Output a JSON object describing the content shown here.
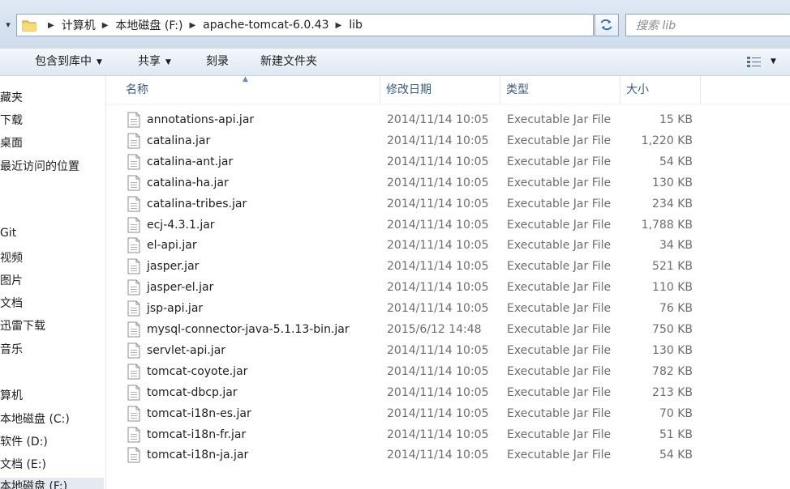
{
  "address": {
    "crumbs": [
      "计算机",
      "本地磁盘 (F:)",
      "apache-tomcat-6.0.43",
      "lib"
    ],
    "search_placeholder": "搜索 lib"
  },
  "toolbar": {
    "include_label": "包含到库中",
    "share_label": "共享",
    "burn_label": "刻录",
    "new_folder_label": "新建文件夹"
  },
  "nav": {
    "items": [
      "藏夹",
      "下载",
      "桌面",
      "最近访问的位置",
      "Git",
      "视频",
      "图片",
      "文档",
      "迅雷下载",
      "音乐",
      "算机",
      "本地磁盘 (C:)",
      "软件 (D:)",
      "文档 (E:)",
      "本地磁盘 (F:)"
    ]
  },
  "columns": {
    "name": "名称",
    "date": "修改日期",
    "type": "类型",
    "size": "大小"
  },
  "files": [
    {
      "name": "annotations-api.jar",
      "date": "2014/11/14 10:05",
      "type": "Executable Jar File",
      "size": "15 KB"
    },
    {
      "name": "catalina.jar",
      "date": "2014/11/14 10:05",
      "type": "Executable Jar File",
      "size": "1,220 KB"
    },
    {
      "name": "catalina-ant.jar",
      "date": "2014/11/14 10:05",
      "type": "Executable Jar File",
      "size": "54 KB"
    },
    {
      "name": "catalina-ha.jar",
      "date": "2014/11/14 10:05",
      "type": "Executable Jar File",
      "size": "130 KB"
    },
    {
      "name": "catalina-tribes.jar",
      "date": "2014/11/14 10:05",
      "type": "Executable Jar File",
      "size": "234 KB"
    },
    {
      "name": "ecj-4.3.1.jar",
      "date": "2014/11/14 10:05",
      "type": "Executable Jar File",
      "size": "1,788 KB"
    },
    {
      "name": "el-api.jar",
      "date": "2014/11/14 10:05",
      "type": "Executable Jar File",
      "size": "34 KB"
    },
    {
      "name": "jasper.jar",
      "date": "2014/11/14 10:05",
      "type": "Executable Jar File",
      "size": "521 KB"
    },
    {
      "name": "jasper-el.jar",
      "date": "2014/11/14 10:05",
      "type": "Executable Jar File",
      "size": "110 KB"
    },
    {
      "name": "jsp-api.jar",
      "date": "2014/11/14 10:05",
      "type": "Executable Jar File",
      "size": "76 KB"
    },
    {
      "name": "mysql-connector-java-5.1.13-bin.jar",
      "date": "2015/6/12 14:48",
      "type": "Executable Jar File",
      "size": "750 KB"
    },
    {
      "name": "servlet-api.jar",
      "date": "2014/11/14 10:05",
      "type": "Executable Jar File",
      "size": "130 KB"
    },
    {
      "name": "tomcat-coyote.jar",
      "date": "2014/11/14 10:05",
      "type": "Executable Jar File",
      "size": "782 KB"
    },
    {
      "name": "tomcat-dbcp.jar",
      "date": "2014/11/14 10:05",
      "type": "Executable Jar File",
      "size": "213 KB"
    },
    {
      "name": "tomcat-i18n-es.jar",
      "date": "2014/11/14 10:05",
      "type": "Executable Jar File",
      "size": "70 KB"
    },
    {
      "name": "tomcat-i18n-fr.jar",
      "date": "2014/11/14 10:05",
      "type": "Executable Jar File",
      "size": "51 KB"
    },
    {
      "name": "tomcat-i18n-ja.jar",
      "date": "2014/11/14 10:05",
      "type": "Executable Jar File",
      "size": "54 KB"
    }
  ]
}
